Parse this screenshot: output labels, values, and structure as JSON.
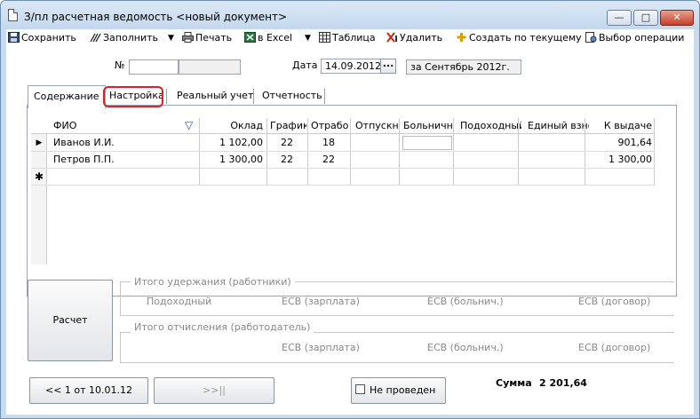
{
  "window": {
    "title": "З/пл расчетная ведомость <новый документ>",
    "minimize": "—",
    "maximize": "□",
    "close": "✕"
  },
  "toolbar": {
    "save": "Сохранить",
    "fill": "Заполнить",
    "print": "Печать",
    "excel": "в Excel",
    "table": "Таблица",
    "delete": "Удалить",
    "create_from": "Создать по текущему",
    "select_operation": "Выбор операции"
  },
  "header": {
    "number_label": "№",
    "number_value": "",
    "date_label": "Дата",
    "date_value": "14.09.2012",
    "ellipsis": "...",
    "period_value": "за Сентябрь 2012г."
  },
  "tabs": [
    {
      "label": "Содержание"
    },
    {
      "label": "Настройка"
    },
    {
      "label": "Реальный учет"
    },
    {
      "label": "Отчетность"
    }
  ],
  "grid": {
    "columns": [
      "ФИО",
      "Оклад",
      "График",
      "Отрабо",
      "Отпускн",
      "Больничн",
      "Подоходный",
      "Единый взно",
      "К выдаче"
    ],
    "rows": [
      {
        "marker": "▶",
        "cells": [
          "Иванов И.И.",
          "1 102,00",
          "22",
          "18",
          "",
          "",
          "",
          "",
          "901,64"
        ]
      },
      {
        "marker": "",
        "cells": [
          "Петров П.П.",
          "1 300,00",
          "22",
          "22",
          "",
          "",
          "",
          "",
          "1 300,00"
        ]
      },
      {
        "marker": "✱",
        "cells": [
          "",
          "",
          "",
          "",
          "",
          "",
          "",
          "",
          ""
        ]
      }
    ],
    "filter_icon": "▽"
  },
  "summary": {
    "calc_button": "Расчет",
    "deductions_title": "Итого удержания (работники)",
    "deductions": [
      "Подоходный",
      "ЕСВ (зарплата)",
      "ЕСВ (больнич.)",
      "ЕСВ (договор)"
    ],
    "charges_title": "Итого отчисления (работодатель)",
    "charges": [
      "ЕСВ (зарплата)",
      "ЕСВ (больнич.)",
      "ЕСВ (договор)"
    ]
  },
  "footer": {
    "prev_button": "<< 1 от 10.01.12",
    "next_button": ">>||",
    "not_posted": "Не проведен",
    "sum_label": "Сумма",
    "sum_value": "2 201,64"
  }
}
